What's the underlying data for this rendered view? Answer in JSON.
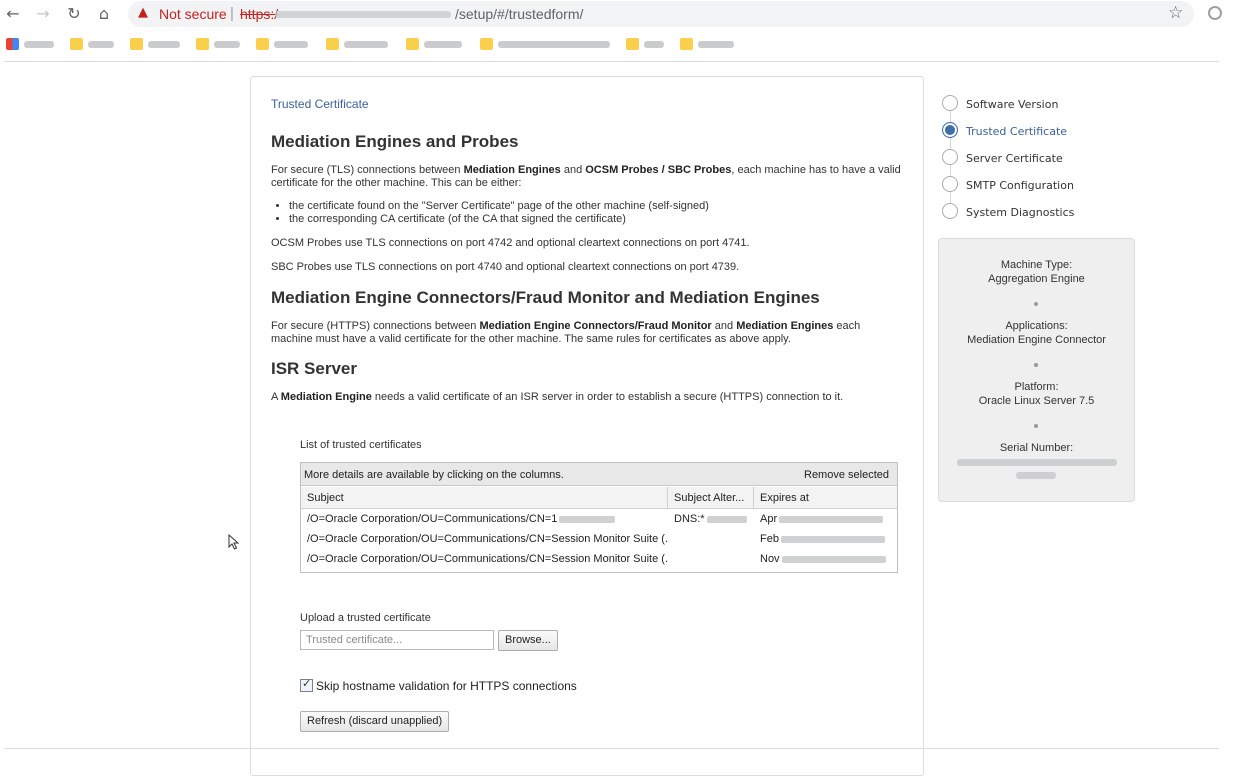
{
  "browser": {
    "back_icon": "arrow-left-icon",
    "forward_icon": "arrow-right-icon",
    "reload_icon": "reload-icon",
    "home_icon": "home-icon",
    "security_label": "Not secure",
    "url_scheme": "https:/",
    "url_path": "/setup/#/trustedform/",
    "bookmark_icon": "star-icon"
  },
  "page": {
    "breadcrumb": "Trusted Certificate",
    "sections": {
      "mediation": {
        "title": "Mediation Engines and Probes",
        "intro_a": "For secure (TLS) connections between ",
        "intro_b": "Mediation Engines",
        "intro_c": " and ",
        "intro_d": "OCSM Probes / SBC Probes",
        "intro_e": ", each machine has to have a valid certificate for the other machine. This can be either:",
        "bullets": [
          "the certificate found on the \"Server Certificate\" page of the other machine (self-signed)",
          "the corresponding CA certificate (of the CA that signed the certificate)"
        ],
        "ocsm_note": "OCSM Probes use TLS connections on port 4742 and optional cleartext connections on port 4741.",
        "sbc_note": "SBC Probes use TLS connections on port 4740 and optional cleartext connections on port 4739."
      },
      "connectors": {
        "title": "Mediation Engine Connectors/Fraud Monitor and Mediation Engines",
        "text_a": "For secure (HTTPS) connections between ",
        "text_b": "Mediation Engine Connectors/Fraud Monitor",
        "text_c": " and ",
        "text_d": "Mediation Engines",
        "text_e": " each machine must have a valid certificate for the other machine. The same rules for certificates as above apply."
      },
      "isr": {
        "title": "ISR Server",
        "text_a": "A ",
        "text_b": "Mediation Engine",
        "text_c": " needs a valid certificate of an ISR server in order to establish a secure (HTTPS) connection to it."
      }
    },
    "trusted_list": {
      "label": "List of trusted certificates",
      "hint": "More details are available by clicking on the columns.",
      "remove_label": "Remove selected",
      "columns": [
        "Subject",
        "Subject Alter...",
        "Expires at"
      ],
      "rows": [
        {
          "subject": "/O=Oracle Corporation/OU=Communications/CN=1",
          "alt": "DNS:*",
          "expires": "Apr"
        },
        {
          "subject": "/O=Oracle Corporation/OU=Communications/CN=Session Monitor Suite (...",
          "alt": "",
          "expires": "Feb"
        },
        {
          "subject": "/O=Oracle Corporation/OU=Communications/CN=Session Monitor Suite (...",
          "alt": "",
          "expires": "Nov"
        }
      ]
    },
    "upload": {
      "label": "Upload a trusted certificate",
      "placeholder": "Trusted certificate...",
      "browse_label": "Browse..."
    },
    "skip_hostname": {
      "label": "Skip hostname validation for HTTPS connections",
      "checked": true
    },
    "refresh_label": "Refresh (discard unapplied)"
  },
  "wizard": {
    "steps": [
      {
        "label": "Software Version",
        "active": false
      },
      {
        "label": "Trusted Certificate",
        "active": true
      },
      {
        "label": "Server Certificate",
        "active": false
      },
      {
        "label": "SMTP Configuration",
        "active": false
      },
      {
        "label": "System Diagnostics",
        "active": false
      }
    ]
  },
  "machine_info": {
    "type_key": "Machine Type:",
    "type_value": "Aggregation Engine",
    "apps_key": "Applications:",
    "apps_value": "Mediation Engine Connector",
    "platform_key": "Platform:",
    "platform_value": "Oracle Linux Server 7.5",
    "serial_key": "Serial Number:"
  },
  "colors": {
    "accent": "#3f6fa9",
    "link": "#3a5f9b",
    "warning": "#c5221f"
  }
}
